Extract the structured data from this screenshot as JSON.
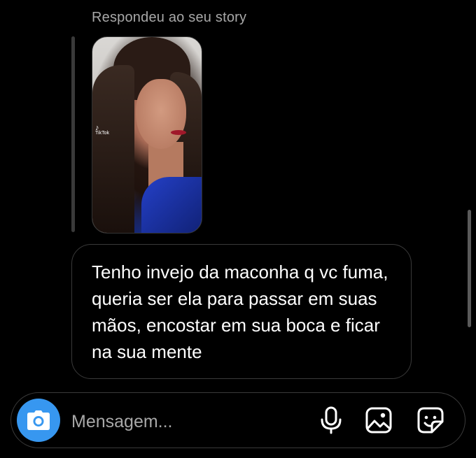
{
  "thread": {
    "reply_caption": "Respondeu ao seu story",
    "story": {
      "watermark_brand": "TikTok"
    },
    "message": {
      "text": "Tenho invejo da maconha q vc fuma, queria ser ela para passar em suas mãos, encostar em sua boca e ficar na sua mente"
    }
  },
  "composer": {
    "placeholder": "Mensagem...",
    "camera_icon": "camera-icon",
    "mic_icon": "microphone-icon",
    "gallery_icon": "image-gallery-icon",
    "sticker_icon": "sticker-icon"
  },
  "colors": {
    "accent": "#3797f0",
    "background": "#000000",
    "muted_text": "#a8a8a8"
  }
}
